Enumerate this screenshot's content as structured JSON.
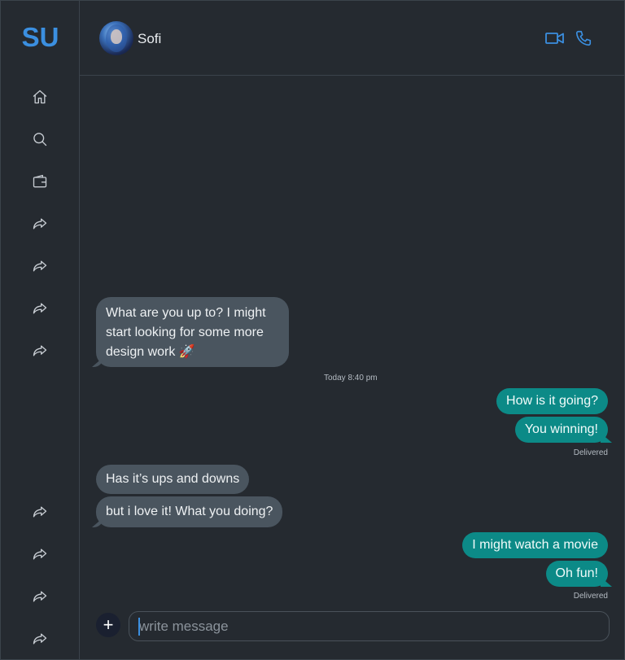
{
  "sidebar": {
    "logo": "SU",
    "nav_icons": [
      "home-icon",
      "search-icon",
      "wallet-icon",
      "share-icon",
      "share-icon",
      "share-icon",
      "share-icon",
      "share-icon",
      "share-icon",
      "share-icon",
      "share-icon"
    ]
  },
  "header": {
    "contact_name": "Sofi",
    "actions": [
      "video-call-icon",
      "phone-icon"
    ],
    "accent_color": "#3b8fe0"
  },
  "messages": [
    {
      "direction": "incoming",
      "text": "What are you up to? I might"
    },
    {
      "direction": "incoming",
      "text": "start looking for some more"
    },
    {
      "direction": "incoming",
      "text": "design work 🚀"
    },
    {
      "direction": "outgoing",
      "text": "How is it going?"
    },
    {
      "direction": "outgoing",
      "text": "You winning!"
    },
    {
      "direction": "incoming",
      "text": "Has it’s ups and downs"
    },
    {
      "direction": "incoming",
      "text": "but i love it! What you doing?"
    },
    {
      "direction": "outgoing",
      "text": "I might watch a movie"
    },
    {
      "direction": "outgoing",
      "text": "Oh fun!"
    }
  ],
  "timestamp": "Today 8:40 pm",
  "status_1": "Delivered",
  "status_2": "Delivered",
  "composer": {
    "plus_label": "+",
    "placeholder": "write message"
  },
  "colors": {
    "background": "#252a30",
    "incoming_bubble": "#4a555f",
    "outgoing_bubble": "#0c8a87"
  }
}
